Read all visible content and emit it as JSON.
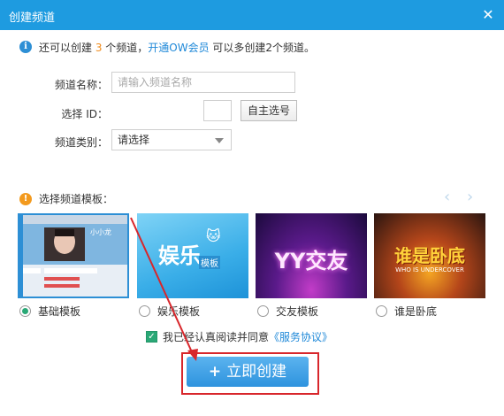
{
  "window": {
    "title": "创建频道",
    "close_icon": "close-icon"
  },
  "info": {
    "prefix": "还可以创建 ",
    "count": "3",
    "mid": " 个频道，",
    "link": "开通OW会员",
    "suffix": " 可以多创建2个频道。"
  },
  "form": {
    "name_label": "频道名称：",
    "name_placeholder": "请输入频道名称",
    "id_label": "选择 ID：",
    "id_button": "自主选号",
    "category_label": "频道类别：",
    "category_value": "请选择"
  },
  "templates": {
    "section_label": "选择频道模板：",
    "items": [
      {
        "label": "基础模板",
        "selected": true
      },
      {
        "label": "娱乐模板",
        "selected": false,
        "art_text": "娱乐",
        "art_sub": "模板"
      },
      {
        "label": "交友模板",
        "selected": false,
        "art_text": "YY交友"
      },
      {
        "label": "谁是卧底",
        "selected": false,
        "art_text": "谁是卧底",
        "art_sub": "WHO IS UNDERCOVER"
      }
    ],
    "basic_preview_name": "小小龙"
  },
  "agree": {
    "prefix": "我已经认真阅读并同意",
    "link": "《服务协议》",
    "checked": true
  },
  "create_button": "立即创建",
  "colors": {
    "accent": "#1e9be0",
    "button": "#2e93de",
    "highlight": "#d8262b",
    "radio_on": "#2aa876"
  }
}
